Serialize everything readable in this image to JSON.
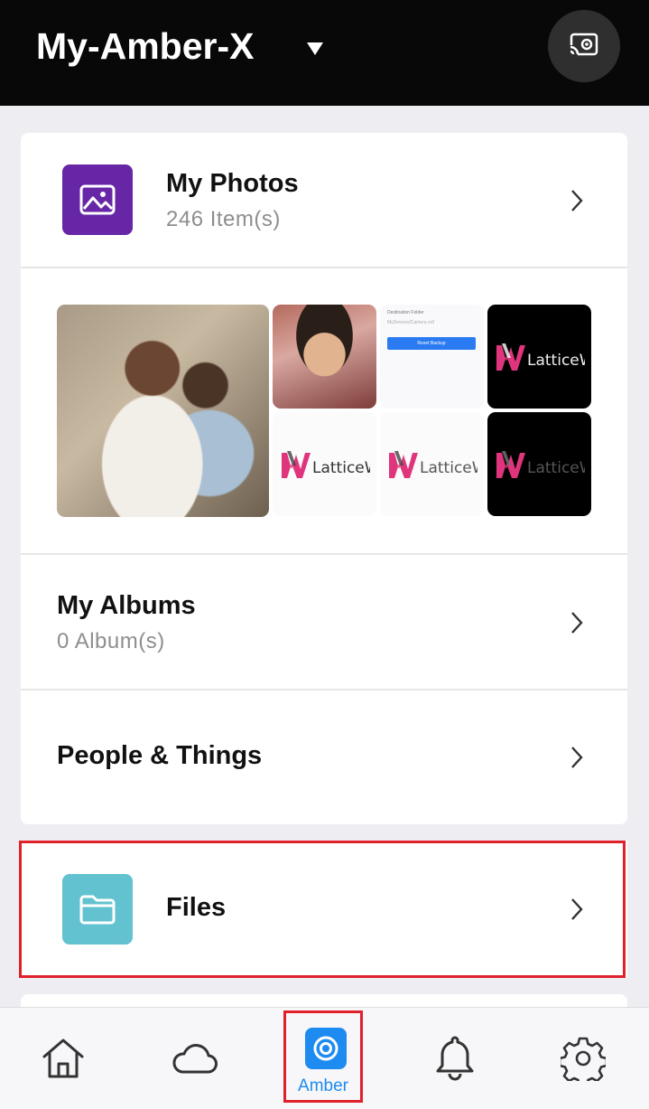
{
  "header": {
    "device_name": "My-Amber-X"
  },
  "photos": {
    "title": "My Photos",
    "count": "246 Item(s)",
    "thumb_logo_text": "LatticeWork",
    "shot_label": "Destination Folder",
    "shot_path": "MyDevices/Camera roll",
    "shot_button": "Reset Backup"
  },
  "albums": {
    "title": "My Albums",
    "count": "0 Album(s)"
  },
  "people": {
    "title": "People & Things"
  },
  "files": {
    "title": "Files"
  },
  "nav": {
    "amber_label": "Amber"
  },
  "colors": {
    "photos_icon_bg": "#6626a5",
    "files_icon_bg": "#62c2cf",
    "accent": "#1e8bf0",
    "highlight": "#e0202a",
    "logo_pink": "#e0357c"
  }
}
